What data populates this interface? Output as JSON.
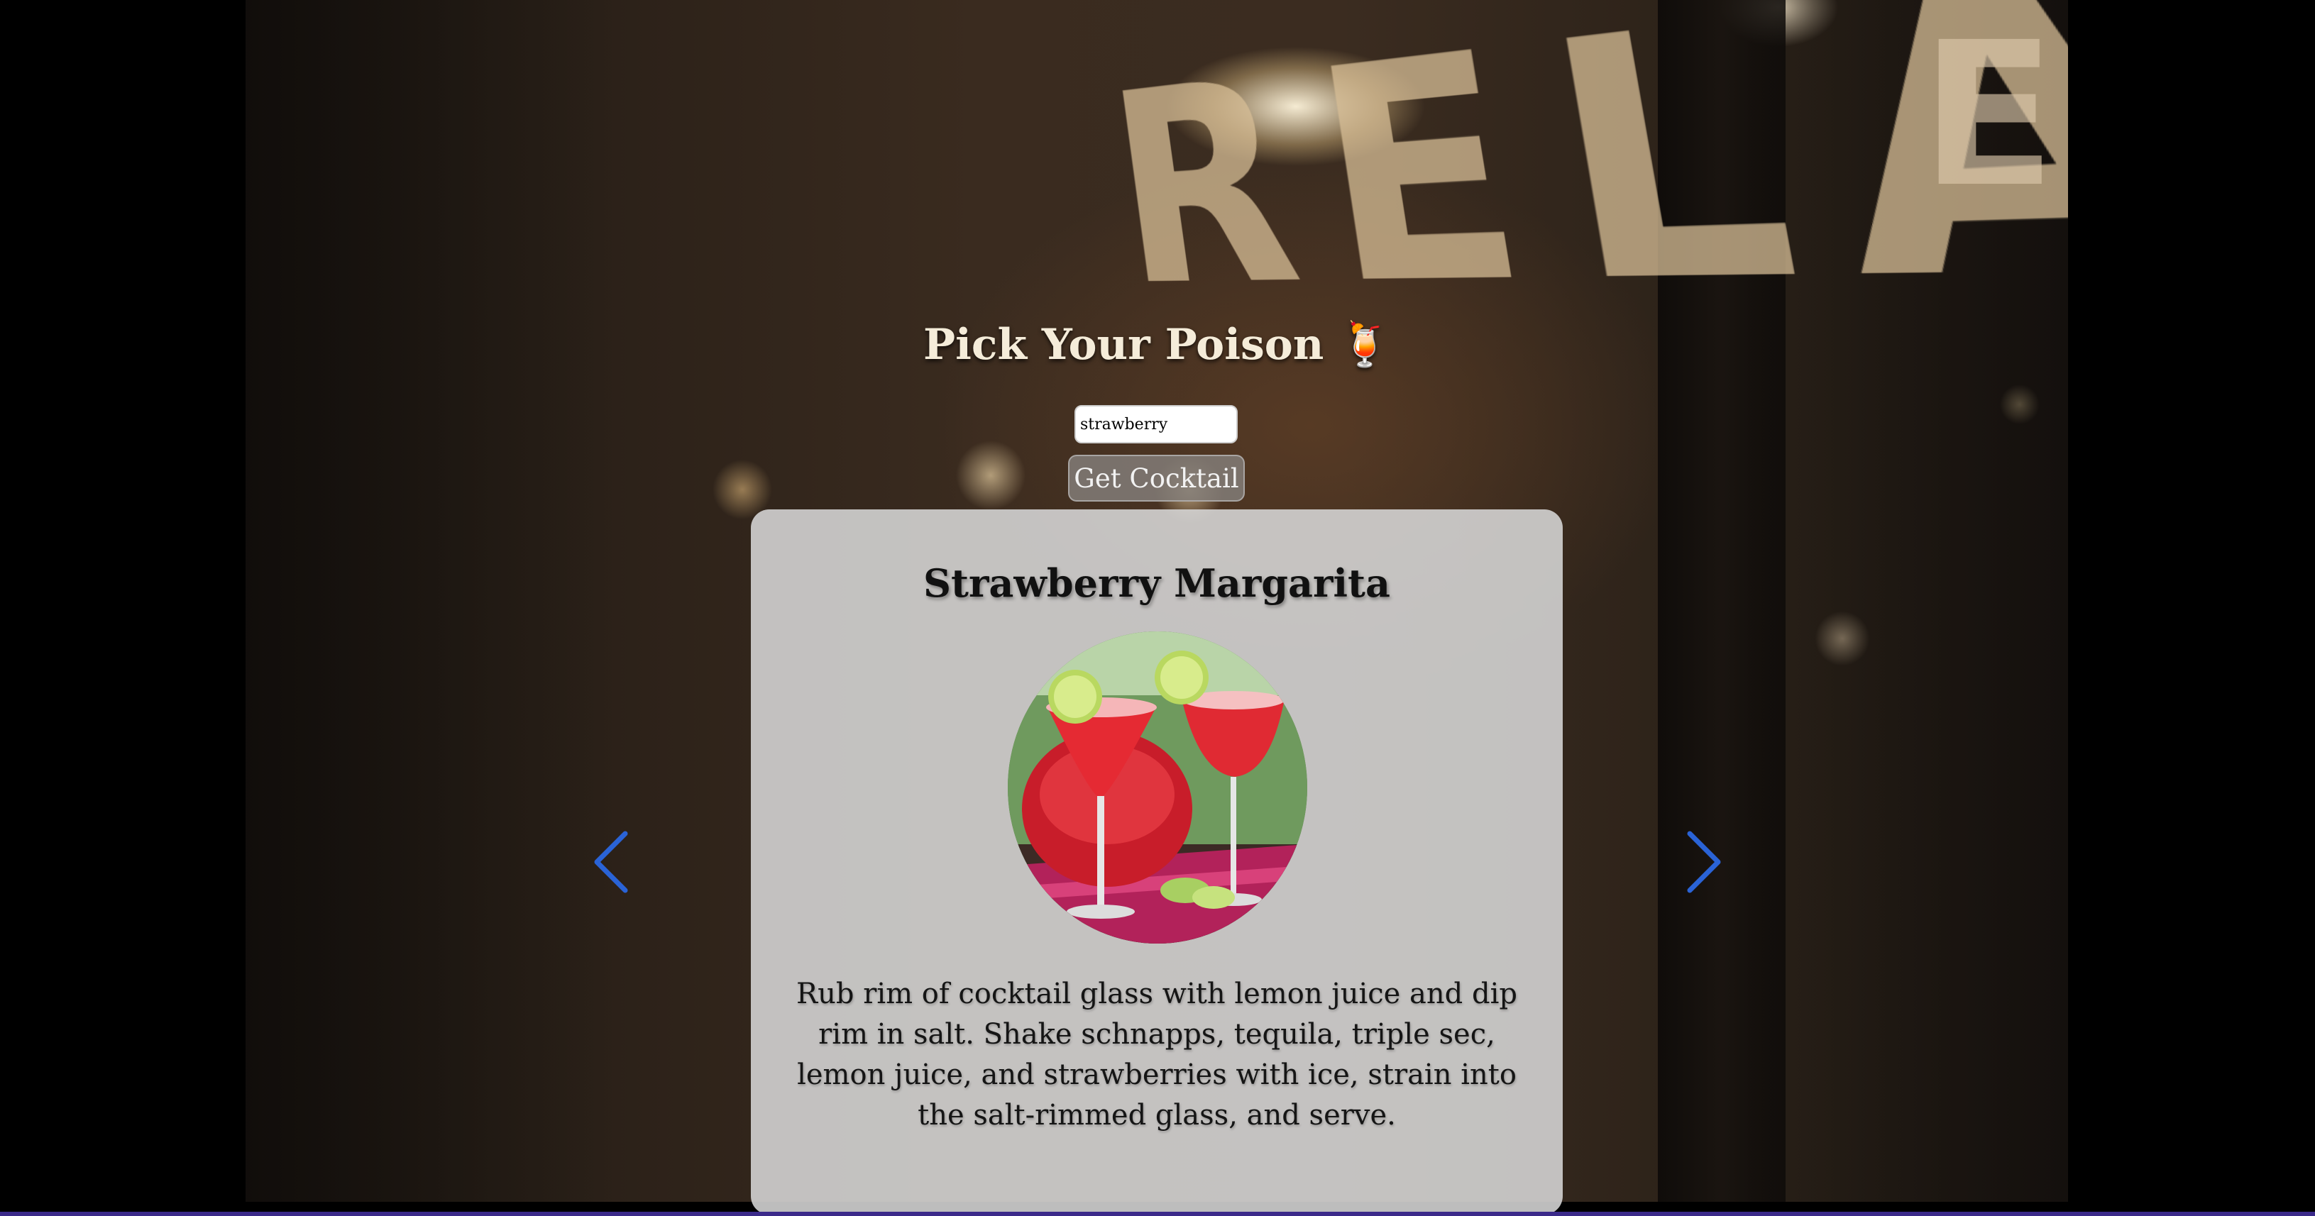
{
  "app": {
    "title": "Pick Your Poison 🍹",
    "background_sign": {
      "word": "RELAX",
      "fragment": "E"
    }
  },
  "search": {
    "value": "strawberry",
    "placeholder": ""
  },
  "actions": {
    "get_cocktail_label": "Get Cocktail"
  },
  "cocktail": {
    "name": "Strawberry Margarita",
    "instructions": "Rub rim of cocktail glass with lemon juice and dip rim in salt. Shake schnapps, tequila, triple sec, lemon juice, and strawberries with ice, strain into the salt-rimmed glass, and serve.",
    "image_alt": "Strawberry Margarita"
  },
  "navigation": {
    "prev_icon": "chevron-left-icon",
    "next_icon": "chevron-right-icon"
  },
  "colors": {
    "arrow": "#2a63d6",
    "card_background": "#d7d7d7",
    "button_background": "#827d78",
    "title_text": "#f5ecd9"
  }
}
